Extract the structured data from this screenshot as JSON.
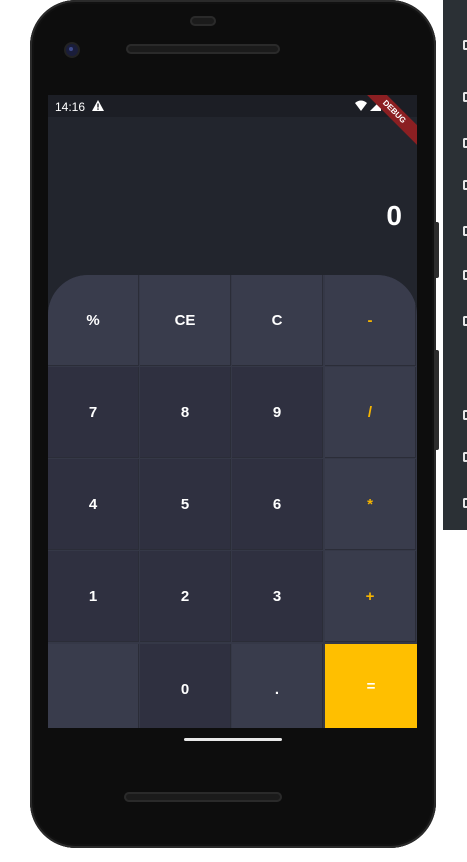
{
  "statusbar": {
    "time": "14:16",
    "debug_label": "DEBUG"
  },
  "display": {
    "value": "0"
  },
  "keypad": {
    "keys": [
      [
        "%",
        "CE",
        "C",
        "-"
      ],
      [
        "7",
        "8",
        "9",
        "/"
      ],
      [
        "4",
        "5",
        "6",
        "*"
      ],
      [
        "1",
        "2",
        "3",
        "+"
      ],
      [
        "",
        "0",
        ".",
        "="
      ]
    ]
  },
  "colors": {
    "accent": "#ffbf00",
    "operator_text": "#f6b500",
    "background": "#22252d",
    "keypad": "#353847"
  }
}
